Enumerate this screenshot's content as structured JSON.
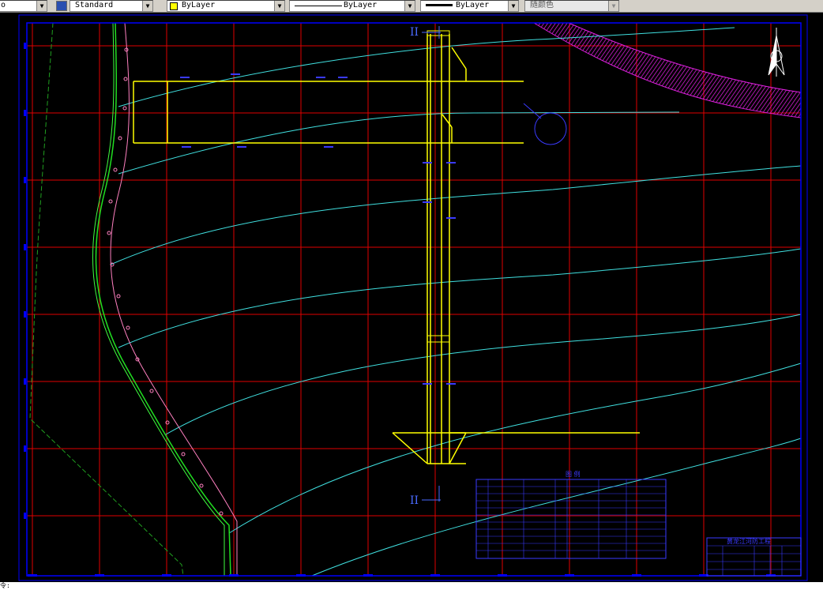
{
  "toolbar": {
    "textstyle_value": "Standard",
    "layer_color_value": "ByLayer",
    "linetype_value": "ByLayer",
    "lineweight_value": "ByLayer",
    "plotstyle_value": "随颜色",
    "left_clip": "o"
  },
  "drawing": {
    "section_mark_top": "II",
    "section_mark_bottom": "II",
    "legend_title": "图 例",
    "titleblock_title": "黄龙江河防工程"
  },
  "cmdline": {
    "prompt": "令: "
  },
  "colors": {
    "grid": "#e00000",
    "border": "#0000ff",
    "contour": "#40e0e0",
    "structure": "#ffff00",
    "annotation": "#3a3aff",
    "levee_green": "#20e020",
    "levee_pink": "#ff80c0",
    "hatch": "#e020e0"
  }
}
